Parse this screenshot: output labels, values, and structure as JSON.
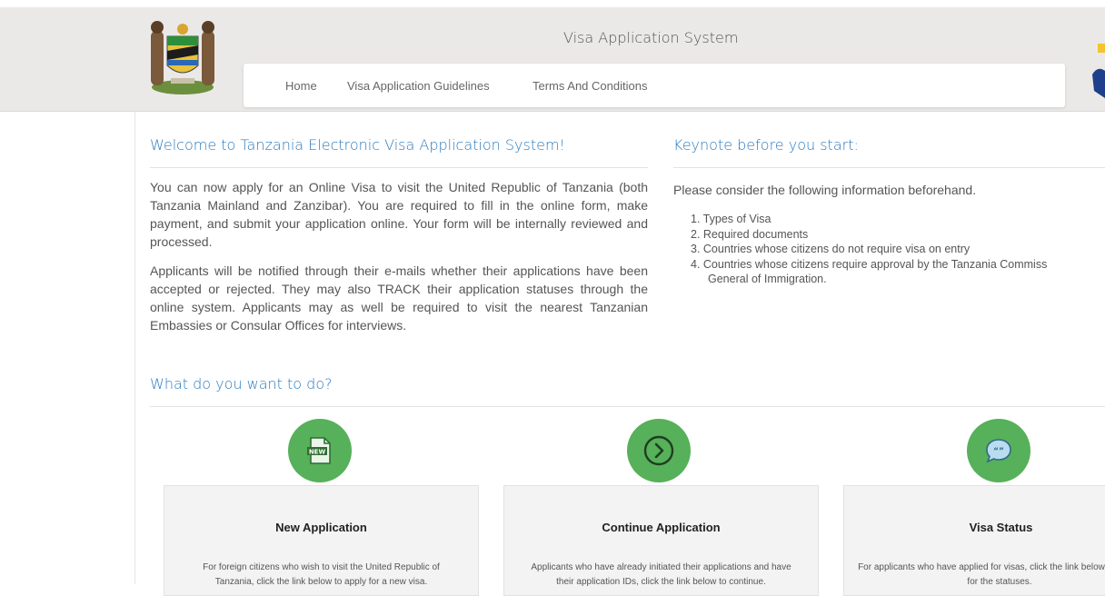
{
  "header": {
    "title": "Visa Application System",
    "nav": [
      "Home",
      "Visa Application Guidelines",
      "Terms And Conditions"
    ]
  },
  "welcome": {
    "title": "Welcome to Tanzania Electronic Visa Application System!",
    "para1": "You can now apply for an Online Visa to visit the United Republic of Tanzania (both Tanzania Mainland and Zanzibar). You are required to fill in the online form, make payment, and submit your application online. Your form will be internally reviewed and processed.",
    "para2": "Applicants will be notified through their e-mails whether their applications have been accepted or rejected. They may also TRACK their application statuses through the online system. Applicants may as well be required to visit the nearest Tanzanian Embassies or Consular Offices for interviews."
  },
  "keynote": {
    "title": "Keynote before you start:",
    "intro": "Please consider the following information beforehand.",
    "items": [
      "1. Types of Visa",
      "2. Required documents",
      "3. Countries whose citizens do not require visa on entry",
      "4. Countries whose citizens require approval by the Tanzania Commiss",
      "General of Immigration."
    ]
  },
  "actions": {
    "title": "What do you want to do?",
    "cards": [
      {
        "title": "New Application",
        "desc": "For foreign citizens who wish to visit the United Republic of Tanzania, click the link below to apply for a new visa.",
        "icon": "new-document-icon"
      },
      {
        "title": "Continue Application",
        "desc": "Applicants who have already initiated their applications and have their application IDs, click the link below to continue.",
        "icon": "chevron-right-circle-icon"
      },
      {
        "title": "Visa Status",
        "desc": "For applicants who have applied for visas, click the link below to check for the statuses.",
        "icon": "chat-bubble-icon"
      }
    ]
  },
  "colors": {
    "accent_blue": "#2b7bbf",
    "icon_green": "#57b05a",
    "header_bg": "#ebe9e7"
  }
}
